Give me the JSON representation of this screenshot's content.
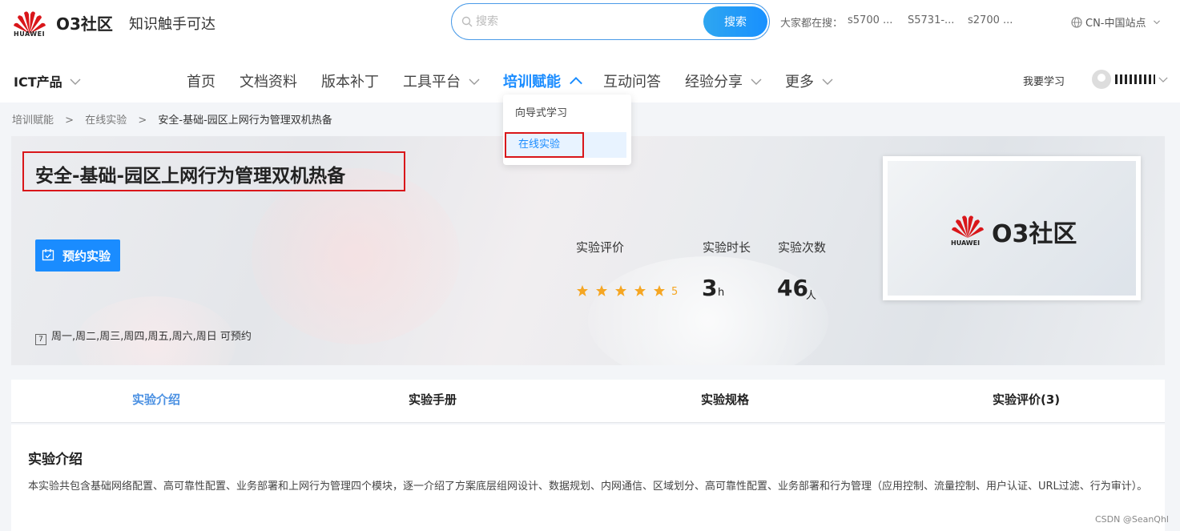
{
  "header": {
    "brand_logo_text": "HUAWEI",
    "site_name": "O3社区",
    "slogan": "知识触手可达",
    "search": {
      "placeholder": "搜索",
      "button_label": "搜索"
    },
    "hot_label": "大家都在搜：",
    "hot_items": [
      "s5700 ...",
      "S5731-...",
      "s2700 ..."
    ],
    "region": "CN-中国站点"
  },
  "nav": {
    "ict_label": "ICT产品",
    "items": [
      "首页",
      "文档资料",
      "版本补丁",
      "工具平台",
      "培训赋能",
      "互动问答",
      "经验分享",
      "更多"
    ],
    "active": "培训赋能",
    "learn_label": "我要学习",
    "dropdown": [
      "向导式学习",
      "在线实验"
    ]
  },
  "breadcrumb": [
    "培训赋能",
    ">",
    "在线实验",
    ">",
    "安全-基础-园区上网行为管理双机热备"
  ],
  "lab": {
    "title": "安全-基础-园区上网行为管理双机热备",
    "book_label": "预约实验",
    "available_days": "周一,周二,周三,周四,周五,周六,周日 可预约",
    "cal_num": "7",
    "stats": {
      "rating_label": "实验评价",
      "rating_value": "5",
      "rating_stars": 5,
      "duration_label": "实验时长",
      "duration_value": "3",
      "duration_unit": "h",
      "count_label": "实验次数",
      "count_value": "46",
      "count_unit": "人"
    },
    "thumb_brand": "HUAWEI",
    "thumb_name": "O3社区"
  },
  "tabs": [
    "实验介绍",
    "实验手册",
    "实验规格",
    "实验评价(3)"
  ],
  "content": {
    "title": "实验介绍",
    "body": "本实验共包含基础网络配置、高可靠性配置、业务部署和上网行为管理四个模块，逐一介绍了方案底层组网设计、数据规划、内网通信、区域划分、高可靠性配置、业务部署和行为管理（应用控制、流量控制、用户认证、URL过滤、行为审计）。"
  },
  "watermark": "CSDN @SeanQhl",
  "colors": {
    "accent": "#1a8cff",
    "brand_red": "#d9161a",
    "star": "#f5a623"
  }
}
